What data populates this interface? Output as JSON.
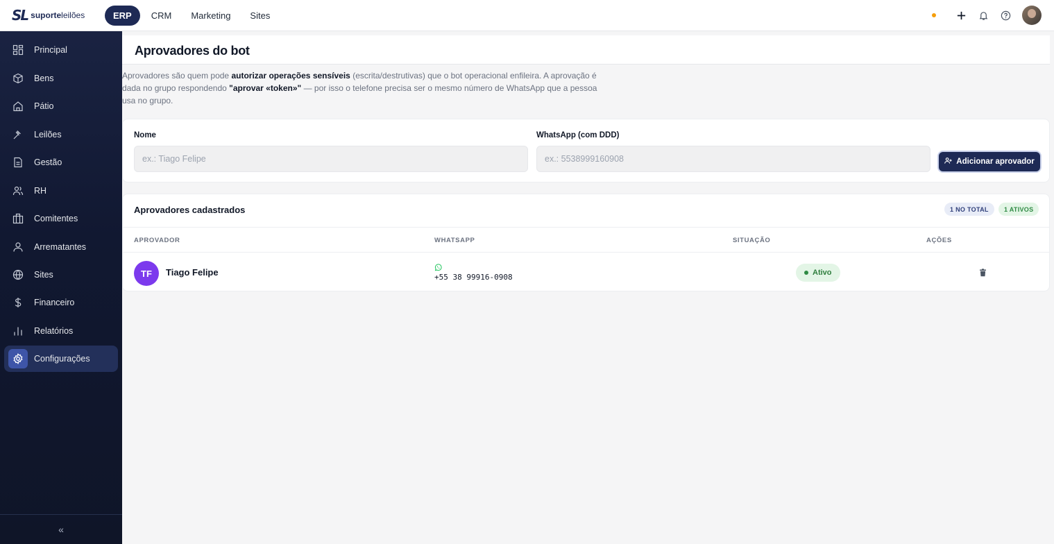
{
  "brand": {
    "mark": "SL",
    "name_bold": "suporte",
    "name_light": "leilões"
  },
  "topnav": [
    {
      "label": "ERP",
      "active": true
    },
    {
      "label": "CRM",
      "active": false
    },
    {
      "label": "Marketing",
      "active": false
    },
    {
      "label": "Sites",
      "active": false
    }
  ],
  "topbar_icons": [
    "status-dot",
    "plus-icon",
    "bell-icon",
    "help-icon",
    "user-avatar"
  ],
  "sidebar": {
    "items": [
      {
        "label": "Principal",
        "icon": "grid-icon"
      },
      {
        "label": "Bens",
        "icon": "box-icon"
      },
      {
        "label": "Pátio",
        "icon": "home-icon"
      },
      {
        "label": "Leilões",
        "icon": "gavel-icon"
      },
      {
        "label": "Gestão",
        "icon": "document-icon"
      },
      {
        "label": "RH",
        "icon": "users-icon"
      },
      {
        "label": "Comitentes",
        "icon": "briefcase-icon"
      },
      {
        "label": "Arrematantes",
        "icon": "user-icon"
      },
      {
        "label": "Sites",
        "icon": "globe-icon"
      },
      {
        "label": "Financeiro",
        "icon": "dollar-icon"
      },
      {
        "label": "Relatórios",
        "icon": "bar-chart-icon"
      },
      {
        "label": "Configurações",
        "icon": "gear-icon",
        "active": true
      }
    ],
    "collapse_label": "«"
  },
  "page": {
    "title": "Aprovadores do bot",
    "intro": {
      "part1": "Aprovadores são quem pode ",
      "bold1": "autorizar operações sensíveis",
      "part2": " (escrita/destrutivas) que o bot operacional enfileira. A aprovação é dada no grupo respondendo ",
      "bold2": "\"aprovar «token»\"",
      "part3": " — por isso o telefone precisa ser o mesmo número de WhatsApp que a pessoa usa no grupo."
    }
  },
  "form": {
    "name_label": "Nome",
    "name_placeholder": "ex.: Tiago Felipe",
    "name_value": "",
    "whatsapp_label": "WhatsApp (com DDD)",
    "whatsapp_placeholder": "ex.: 5538999160908",
    "whatsapp_value": "",
    "add_button": "Adicionar aprovador"
  },
  "list": {
    "title": "Aprovadores cadastrados",
    "badge_total": "1 NO TOTAL",
    "badge_active": "1 ATIVOS",
    "columns": [
      "APROVADOR",
      "WHATSAPP",
      "SITUAÇÃO",
      "AÇÕES"
    ],
    "rows": [
      {
        "initials": "TF",
        "name": "Tiago Felipe",
        "whatsapp": "+55 38 99916-0908",
        "status": "Ativo"
      }
    ]
  },
  "colors": {
    "primary": "#1e2a55",
    "active_green": "#2e8a43",
    "avatar_purple": "#7c3aed",
    "sidebar_bg": "#111831"
  }
}
